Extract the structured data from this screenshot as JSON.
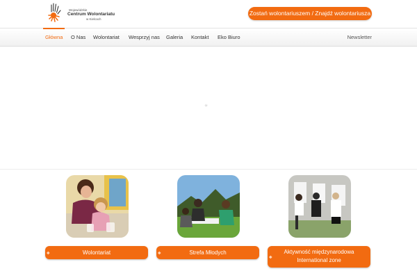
{
  "logo": {
    "line1": "Wojewódzkie",
    "line2": "Centrum Wolontariatu",
    "line3": "w Kielcach"
  },
  "cta": {
    "label": "Zostań wolontariuszem / Znajdź wolontariusza"
  },
  "nav": {
    "items": [
      {
        "label": "Główna"
      },
      {
        "label": "O Nas"
      },
      {
        "label": "Wolontariat"
      },
      {
        "label": "Wesprzyj nas"
      },
      {
        "label": "Galeria"
      },
      {
        "label": "Kontakt"
      },
      {
        "label": "Eko Biuro"
      }
    ],
    "newsletter": "Newsletter"
  },
  "cards": [
    {
      "label": "Wolontariat"
    },
    {
      "label": "Strefa Młodych"
    },
    {
      "label_line1": "Aktywność międzynarodowa",
      "label_line2": "International zone"
    }
  ],
  "colors": {
    "accent": "#f26b11"
  }
}
